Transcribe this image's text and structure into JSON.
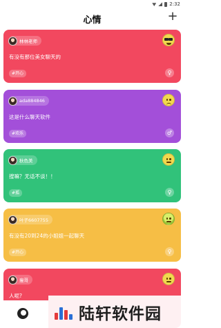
{
  "status_bar": {
    "time": "2:32"
  },
  "header": {
    "title": "心情",
    "add_label": "+"
  },
  "cards": [
    {
      "username": "林林老师",
      "text": "有没有那位美女聊天的",
      "tag": "#开心",
      "mood_icon": "cool-face-icon",
      "color": "#f2485f"
    },
    {
      "username": "ada884846",
      "text": "这是什么聊天软件",
      "tag": "#欢乐",
      "mood_icon": "sad-face-icon",
      "color": "#a34fd9"
    },
    {
      "username": "秋色美",
      "text": "搜嘛？无话不谈！！",
      "tag": "#孤",
      "mood_icon": "neutral-face-icon",
      "color": "#31c27a"
    },
    {
      "username": "叶子6607755",
      "text": "有没有20到24的小姐姐一起聊天",
      "tag": "#开心",
      "mood_icon": "melon-face-icon",
      "color": "#f6be45"
    },
    {
      "username": "瘦哥",
      "text": "人呢?",
      "tag": "",
      "mood_icon": "neutral-face-icon",
      "color": "#f2485f"
    }
  ],
  "watermark": {
    "text": "陆轩软件园"
  }
}
